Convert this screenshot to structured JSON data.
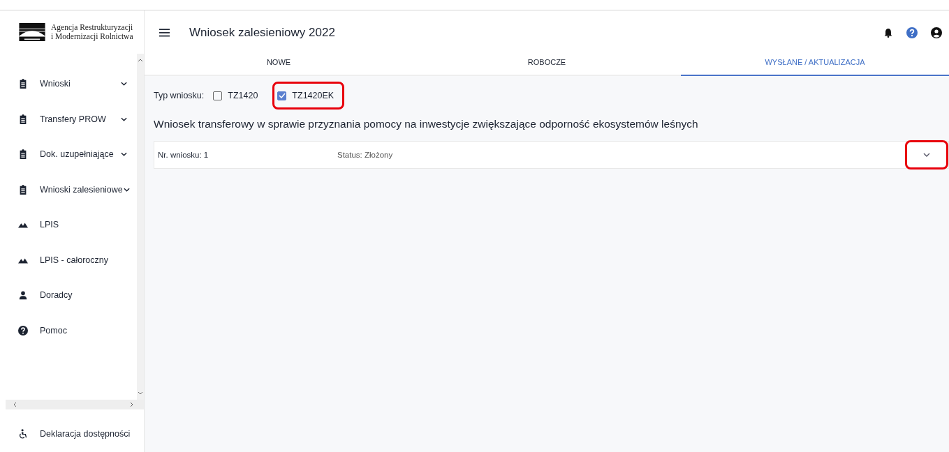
{
  "logo": {
    "line_1": "Agencja Restrukturyzacji",
    "line_2": "i Modernizacji Rolnictwa",
    "kind": "emblem"
  },
  "header": {
    "title": "Wniosek zalesieniowy 2022"
  },
  "sidebar": {
    "items": [
      {
        "label": "Wnioski",
        "kind": "clipboard",
        "expanded": false
      },
      {
        "label": "Transfery PROW",
        "kind": "clipboard",
        "expanded": false
      },
      {
        "label": "Dok. uzupełniające",
        "kind": "clipboard",
        "expanded": false
      },
      {
        "label": "Wnioski zalesieniowe",
        "kind": "clipboard",
        "expanded": false
      },
      {
        "label": "LPIS",
        "kind": "map"
      },
      {
        "label": "LPIS - całoroczny",
        "kind": "map"
      },
      {
        "label": "Doradcy",
        "kind": "person"
      },
      {
        "label": "Pomoc",
        "kind": "help"
      }
    ],
    "footer": {
      "label": "Deklaracja dostępności",
      "kind": "accessibility"
    }
  },
  "tabs": [
    {
      "label": "NOWE",
      "selected": false
    },
    {
      "label": "ROBOCZE",
      "selected": false
    },
    {
      "label": "WYSŁANE / AKTUALIZACJA",
      "selected": true
    }
  ],
  "filter": {
    "label": "Typ wniosku:",
    "options": [
      {
        "label": "TZ1420",
        "checked": false,
        "highlighted": false
      },
      {
        "label": "TZ1420EK",
        "checked": true,
        "highlighted": true
      }
    ]
  },
  "section_title": "Wniosek transferowy w sprawie przyznania pomocy na inwestycje zwiększające odporność ekosystemów leśnych",
  "applications": [
    {
      "number": "Nr. wniosku: 1",
      "status": "Status: Złożony",
      "expanded": false,
      "toggle_highlighted": true
    }
  ]
}
